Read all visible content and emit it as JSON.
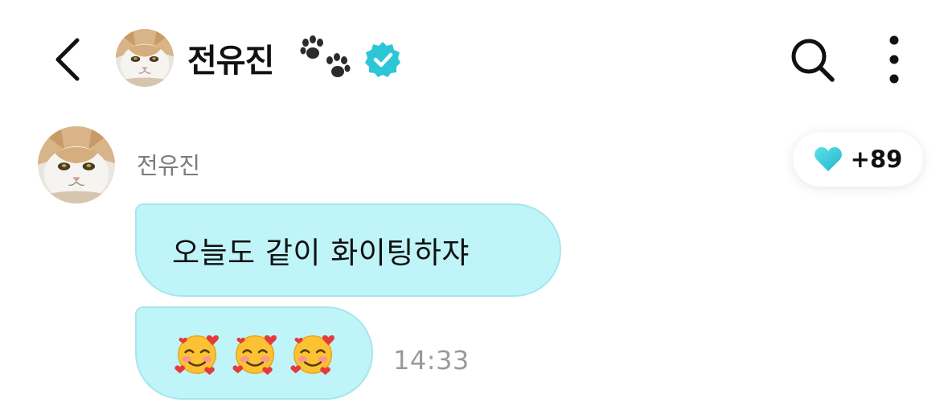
{
  "header": {
    "contact_name": "전유진",
    "back_icon": "chevron-left-icon",
    "avatar_icon": "cat-avatar",
    "name_emoji_icon": "paw-prints-icon",
    "verified_icon": "verified-badge-icon",
    "search_icon": "search-icon",
    "more_icon": "more-vertical-icon"
  },
  "message_group": {
    "sender_name": "전유진",
    "like_count": "+89",
    "like_icon": "heart-icon",
    "messages": [
      {
        "type": "text",
        "text": "오늘도 같이 화이팅하쟈"
      },
      {
        "type": "emoji",
        "emojis": [
          "smiling-face-with-hearts-icon",
          "smiling-face-with-hearts-icon",
          "smiling-face-with-hearts-icon"
        ]
      }
    ],
    "timestamp": "14:33"
  },
  "colors": {
    "bubble_fill": "#bff4f8",
    "bubble_border": "#a6e6ee",
    "accent_teal": "#2cc7d6",
    "timestamp_gray": "#9a9a9a",
    "sender_gray": "#7c7c7c"
  }
}
